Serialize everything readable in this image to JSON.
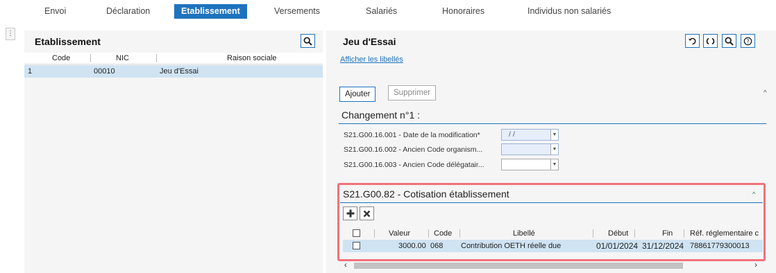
{
  "tabs": [
    {
      "label": "Envoi",
      "active": false
    },
    {
      "label": "Déclaration",
      "active": false
    },
    {
      "label": "Etablissement",
      "active": true
    },
    {
      "label": "Versements",
      "active": false
    },
    {
      "label": "Salariés",
      "active": false
    },
    {
      "label": "Honoraires",
      "active": false
    },
    {
      "label": "Individus non salariés",
      "active": false
    }
  ],
  "gutter_handle": "⋮",
  "left_panel": {
    "title": "Etablissement",
    "columns": [
      "Code",
      "NIC",
      "Raison sociale"
    ],
    "rows": [
      {
        "index": "1",
        "code": "",
        "nic": "00010",
        "raison_sociale": "Jeu d'Essai"
      }
    ]
  },
  "right_panel": {
    "title": "Jeu d'Essai",
    "show_labels_link": "Afficher les libellés",
    "add_button": "Ajouter",
    "delete_button": "Supprimer",
    "change_section_title": "Changement n°1 :",
    "fields": [
      {
        "label": "S21.G00.16.001 - Date de la modification*",
        "value": "/   /"
      },
      {
        "label": "S21.G00.16.002 - Ancien Code organism...",
        "value": ""
      },
      {
        "label": "S21.G00.16.003 - Ancien Code délégatair...",
        "value": ""
      }
    ],
    "cotisation": {
      "title": "S21.G00.82 - Cotisation établissement",
      "columns": [
        "Valeur",
        "Code",
        "Libellé",
        "Début",
        "Fin",
        "Réf. réglementaire c"
      ],
      "rows": [
        {
          "valeur": "3000.00",
          "code": "068",
          "libelle": "Contribution OETH réelle due",
          "debut": "01/01/2024",
          "fin": "31/12/2024",
          "ref": "78861779300013"
        }
      ]
    }
  },
  "colors": {
    "accent": "#1e73be",
    "highlight": "#f0727a",
    "row_selected": "#cfe3f3"
  }
}
